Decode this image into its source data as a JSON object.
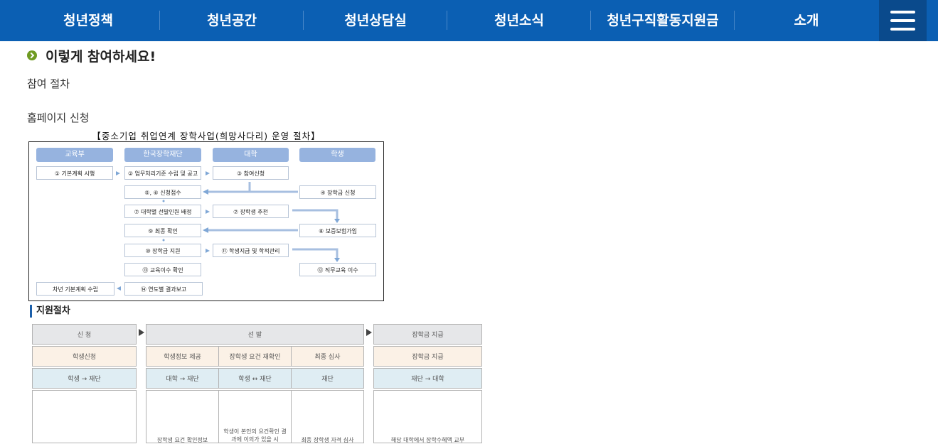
{
  "nav": {
    "items": [
      "청년정책",
      "청년공간",
      "청년상담실",
      "청년소식",
      "청년구직활동지원금",
      "소개"
    ]
  },
  "section": {
    "title": "이렇게 참여하세요!",
    "line1": "참여 절차",
    "line2": "홈페이지 신청"
  },
  "procedure": {
    "caption": "【중소기업 취업연계 장학사업(희망사다리) 운영 절차】",
    "headers": [
      "교육부",
      "한국장학재단",
      "대학",
      "학생"
    ],
    "steps": {
      "s1": "① 기본계획 시행",
      "s2": "② 업무처리기준 수립 및 공고",
      "s3": "③ 참여신청",
      "s4": "④ 장학금 신청",
      "s5": "⑤, ⑥ 신청접수",
      "s6": "⑦ 대학별 선발인원 배정",
      "s7": "⑦ 장학생 추천",
      "s8": "⑧ 보증보험가입",
      "s9": "⑨ 최종 확인",
      "s10": "⑩ 장학금 지원",
      "s11": "⑪ 학생지급 및 학적관리",
      "s12": "⑫ 직무교육 이수",
      "s13": "⑬ 교육이수 확인",
      "s14": "차년 기본계획 수립",
      "s15": "⑭ 연도별 결과보고"
    }
  },
  "support": {
    "label": "지원절차",
    "stages": [
      "신 청",
      "선 발",
      "장학금 지급"
    ],
    "row2": [
      "학생신청",
      "학생정보 제공",
      "장학생 요건 재확인",
      "최종 심사",
      "장학금 지급"
    ],
    "row3": [
      "학생 → 재단",
      "대학 → 재단",
      "학생 ↔ 재단",
      "재단",
      "재단 → 대학"
    ],
    "desc": [
      "",
      "장학생 요건 확인정보",
      "학생이 본인의 요건확인 결과에 이의가 있을 시",
      "최종 장학생 자격 심사",
      "해당 대학에서 장학수혜액 교부"
    ]
  }
}
